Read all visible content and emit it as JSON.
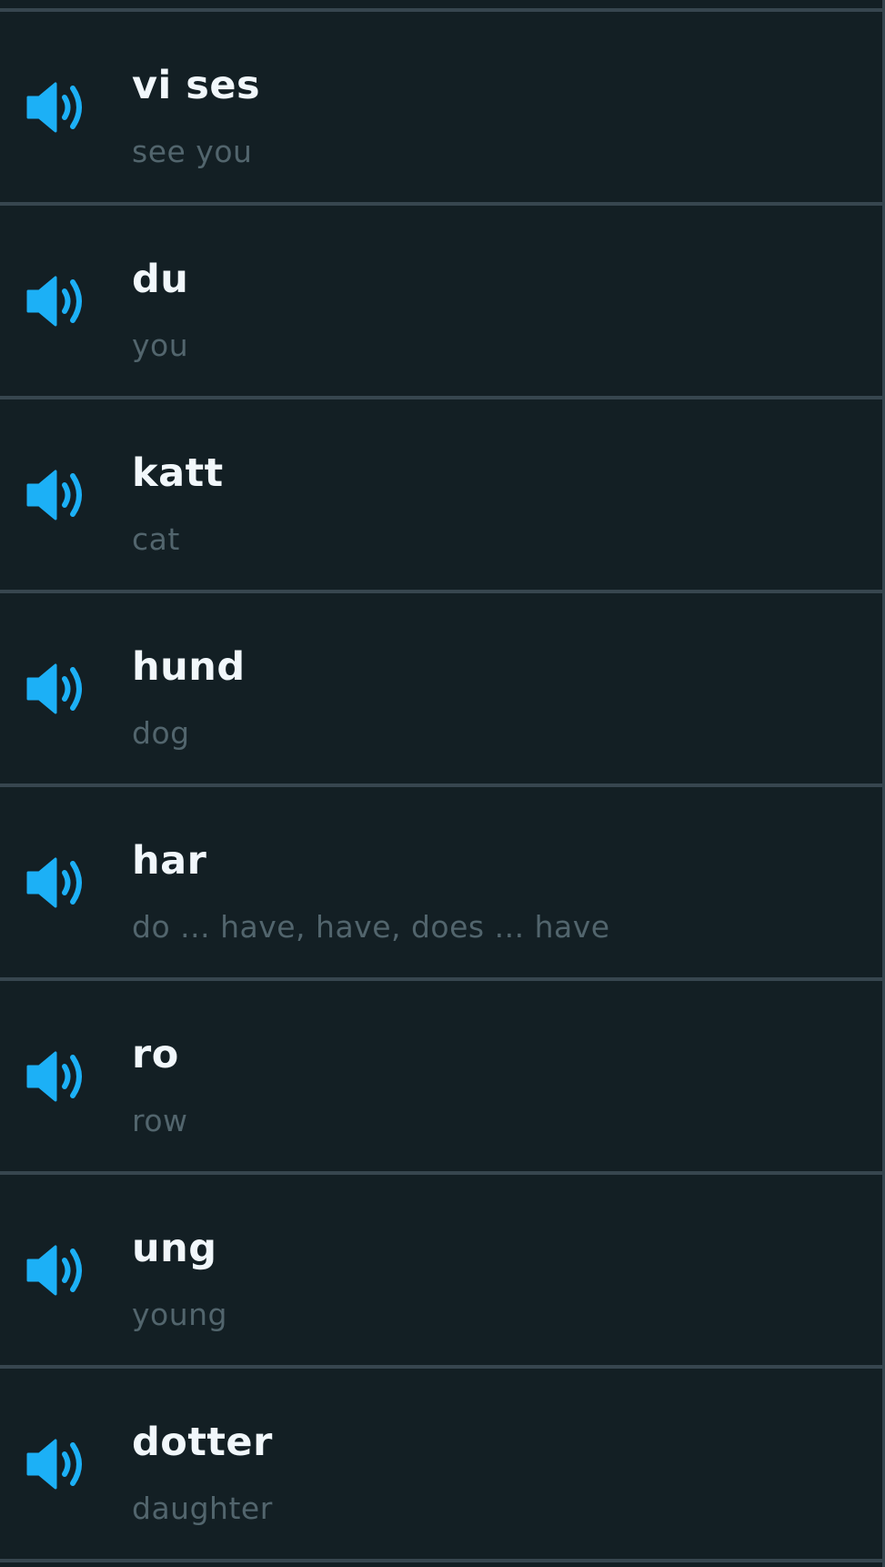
{
  "accent_color": "#1cb0f6",
  "words": [
    {
      "word": "vi ses",
      "translation": "see you",
      "icon": "speaker-icon"
    },
    {
      "word": "du",
      "translation": "you",
      "icon": "speaker-icon"
    },
    {
      "word": "katt",
      "translation": "cat",
      "icon": "speaker-icon"
    },
    {
      "word": "hund",
      "translation": "dog",
      "icon": "speaker-icon"
    },
    {
      "word": "har",
      "translation": "do ... have, have, does ... have",
      "icon": "speaker-icon"
    },
    {
      "word": "ro",
      "translation": "row",
      "icon": "speaker-icon"
    },
    {
      "word": "ung",
      "translation": "young",
      "icon": "speaker-icon"
    },
    {
      "word": "dotter",
      "translation": "daughter",
      "icon": "speaker-icon"
    }
  ]
}
